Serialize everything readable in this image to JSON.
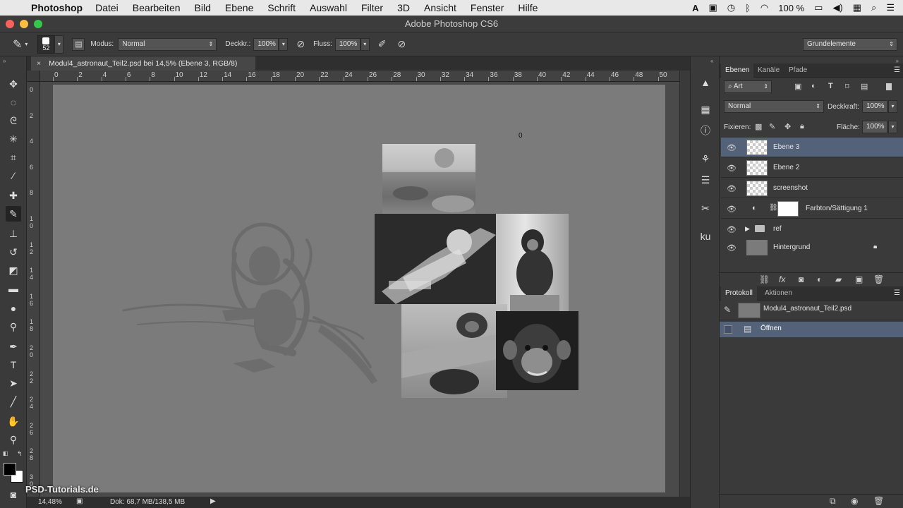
{
  "menubar": {
    "app": "Photoshop",
    "items": [
      "Datei",
      "Bearbeiten",
      "Bild",
      "Ebene",
      "Schrift",
      "Auswahl",
      "Filter",
      "3D",
      "Ansicht",
      "Fenster",
      "Hilfe"
    ],
    "battery": "100 %"
  },
  "window": {
    "title": "Adobe Photoshop CS6"
  },
  "options": {
    "brush_size": "52",
    "mode_label": "Modus:",
    "mode_value": "Normal",
    "opacity_label": "Deckkr.:",
    "opacity_value": "100%",
    "flow_label": "Fluss:",
    "flow_value": "100%",
    "workspace": "Grundelemente"
  },
  "document": {
    "tab_title": "Modul4_astronaut_Teil2.psd bei 14,5% (Ebene 3, RGB/8)",
    "ruler_h": [
      "0",
      "2",
      "4",
      "6",
      "8",
      "10",
      "12",
      "14",
      "16",
      "18",
      "20",
      "22",
      "24",
      "26",
      "28",
      "30",
      "32",
      "34",
      "36",
      "38",
      "40",
      "42",
      "44",
      "46",
      "48",
      "50"
    ],
    "ruler_v": [
      [
        "0"
      ],
      [
        "2"
      ],
      [
        "4"
      ],
      [
        "6"
      ],
      [
        "8"
      ],
      [
        "1",
        "0"
      ],
      [
        "1",
        "2"
      ],
      [
        "1",
        "4"
      ],
      [
        "1",
        "6"
      ],
      [
        "1",
        "8"
      ],
      [
        "2",
        "0"
      ],
      [
        "2",
        "2"
      ],
      [
        "2",
        "4"
      ],
      [
        "2",
        "6"
      ],
      [
        "2",
        "8"
      ],
      [
        "3",
        "0"
      ]
    ],
    "canvas_marker": "0"
  },
  "status": {
    "zoom": "14,48%",
    "doc_info": "Dok: 68,7 MB/138,5 MB"
  },
  "layers_panel": {
    "tabs": [
      "Ebenen",
      "Kanäle",
      "Pfade"
    ],
    "filter_kind": "Art",
    "blend_mode": "Normal",
    "opacity_label": "Deckkraft:",
    "opacity_value": "100%",
    "lock_label": "Fixieren:",
    "fill_label": "Fläche:",
    "fill_value": "100%",
    "layers": [
      {
        "name": "Ebene 3",
        "selected": true
      },
      {
        "name": "Ebene 2",
        "selected": false
      },
      {
        "name": "screenshot",
        "selected": false
      },
      {
        "name": "Farbton/Sättigung 1",
        "selected": false
      },
      {
        "name": "ref",
        "selected": false
      },
      {
        "name": "Hintergrund",
        "selected": false
      }
    ]
  },
  "history_panel": {
    "tabs": [
      "Protokoll",
      "Aktionen"
    ],
    "snapshot": "Modul4_astronaut_Teil2.psd",
    "steps": [
      "Öffnen"
    ]
  },
  "watermark": "PSD-Tutorials.de",
  "colors": {
    "selected_layer": "#536179",
    "canvas": "#7b7b7b",
    "panel_bg": "#3a3a3a"
  }
}
